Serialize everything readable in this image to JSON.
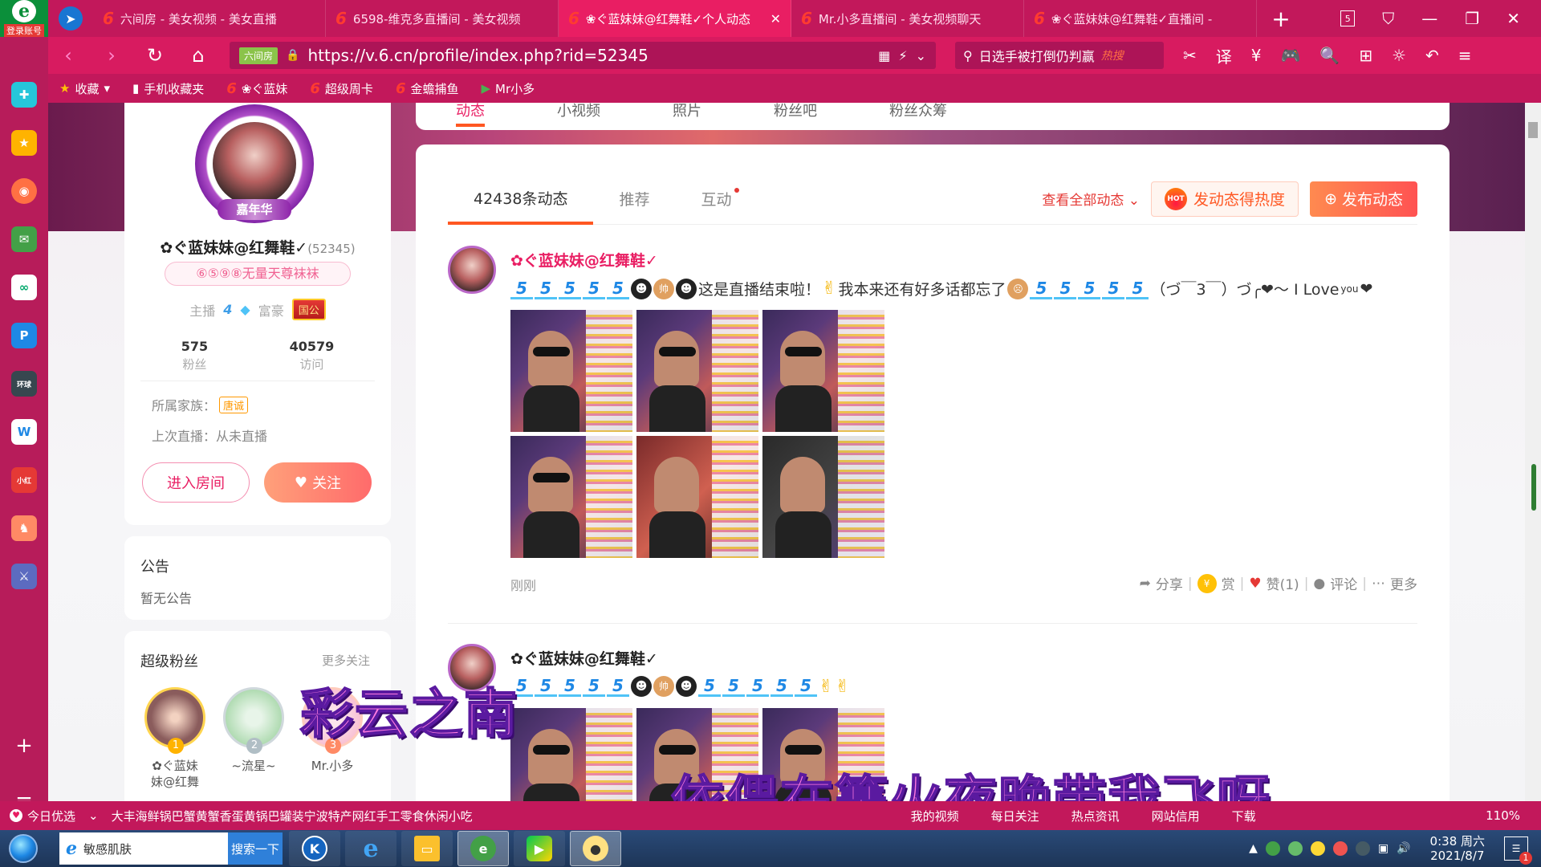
{
  "browser": {
    "login_label": "登录账号",
    "tabs": [
      {
        "label": "六间房 - 美女视频 - 美女直播",
        "active": false
      },
      {
        "label": "6598-维克多直播间 - 美女视频",
        "active": false
      },
      {
        "label": "❀ぐ蓝妹妹@红舞鞋✓个人动态",
        "active": true
      },
      {
        "label": "Mr.小多直播间 - 美女视频聊天",
        "active": false
      },
      {
        "label": "❀ぐ蓝妹妹@红舞鞋✓直播间 -",
        "active": false
      }
    ],
    "tab_count": "5",
    "site_tag": "六间房",
    "url": "https://v.6.cn/profile/index.php?rid=52345",
    "search_text": "日选手被打倒仍判赢",
    "search_hot": "热搜",
    "translate_label": "译",
    "bookmarks": [
      "收藏",
      "手机收藏夹",
      "❀ぐ蓝妹",
      "超级周卡",
      "金蟾捕鱼",
      "Mr小多"
    ]
  },
  "profile": {
    "avatar_badge": "嘉年华",
    "name": "✿ぐ蓝妹妹@红舞鞋✓",
    "rid": "(52345)",
    "tag": "⑥⑤⑨⑧无量天尊袜袜",
    "level_anchor_label": "主播",
    "level_anchor": "4",
    "level_rich_label": "富豪",
    "rich_badge": "国公",
    "fans_count": "575",
    "fans_label": "粉丝",
    "visits_count": "40579",
    "visits_label": "访问",
    "family_label": "所属家族：",
    "family_name": "唐诚",
    "last_live": "上次直播：从未直播",
    "enter_room": "进入房间",
    "follow": "关注"
  },
  "notice": {
    "title": "公告",
    "content": "暂无公告"
  },
  "super_fans": {
    "title": "超级粉丝",
    "more": "更多关注",
    "list": [
      {
        "rank": "1",
        "name": "✿ぐ蓝妹\n妹@红舞"
      },
      {
        "rank": "2",
        "name": "~流星~"
      },
      {
        "rank": "3",
        "name": "Mr.小多"
      }
    ]
  },
  "top_tabs": [
    "动态",
    "小视频",
    "照片",
    "粉丝吧",
    "粉丝众筹"
  ],
  "feed": {
    "tabs": [
      "42438条动态",
      "推荐",
      "互动"
    ],
    "view_all": "查看全部动态",
    "hot_button": "发动态得热度",
    "hot_icon": "HOT",
    "post_button": "发布动态",
    "posts": [
      {
        "author": "✿ぐ蓝妹妹@红舞鞋✓",
        "text_a": "这是直播结束啦！",
        "text_b": "我本来还有好多话都忘了",
        "text_c": "（づ￣3￣）づ╭❤～ I Love",
        "text_you": "you",
        "time": "刚刚",
        "share": "分享",
        "reward": "赏",
        "like": "赞(1)",
        "comment": "评论",
        "more": "更多"
      },
      {
        "author": "✿ぐ蓝妹妹@红舞鞋✓"
      }
    ]
  },
  "subtitles": {
    "line1": "彩云之南",
    "line2": "依偎在篝火夜晚带我飞呀"
  },
  "statusbar": {
    "today": "今日优选",
    "news": "大丰海鲜锅巴蟹黄蟹香蛋黄锅巴罐装宁波特产网红手工零食休闲小吃",
    "items": [
      "我的视频",
      "每日关注",
      "热点资讯",
      "网站信用",
      "下载"
    ],
    "zoom": "110%"
  },
  "taskbar": {
    "search_text": "敏感肌肤",
    "search_btn": "搜索一下",
    "time": "0:38 周六",
    "date": "2021/8/7",
    "notif_count": "1"
  }
}
